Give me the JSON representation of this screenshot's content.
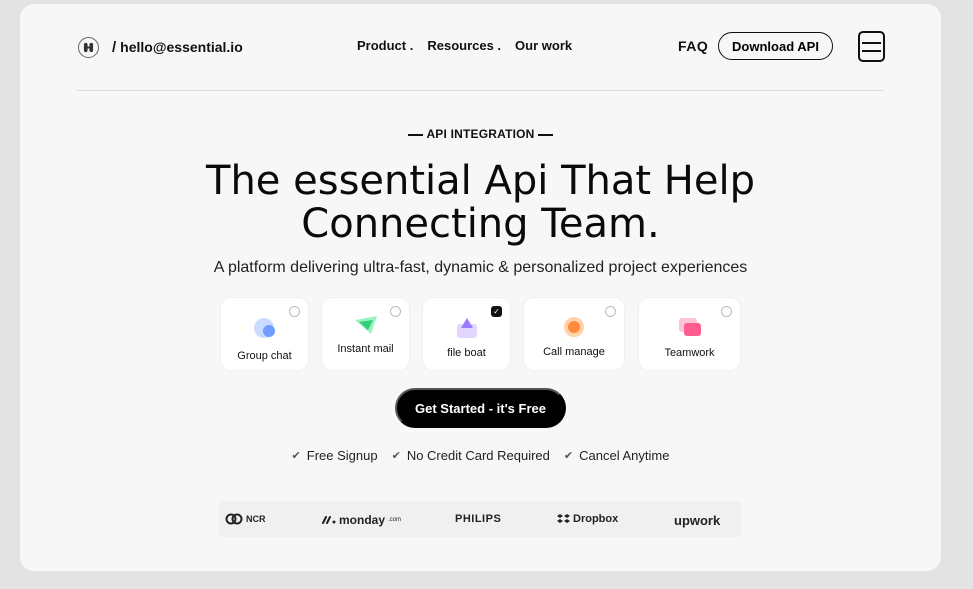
{
  "header": {
    "logo_icon": "brand-logo-icon",
    "email_prefix": "/",
    "email": "hello@essential.io",
    "nav": [
      "Product .",
      "Resources .",
      "Our work"
    ],
    "faq": "FAQ",
    "download": "Download API",
    "menu_icon": "hamburger-icon"
  },
  "hero": {
    "eyebrow": "API INTEGRATION",
    "title_line1": "The essential Api That Help",
    "title_line2": "Connecting Team.",
    "subtitle": "A platform delivering ultra-fast, dynamic & personalized project experiences"
  },
  "features": [
    {
      "label": "Group chat",
      "icon": "group-chat-icon",
      "checked": false,
      "color": "#7aa7ff"
    },
    {
      "label": "Instant mail",
      "icon": "instant-mail-icon",
      "checked": false,
      "color": "#3dd68c"
    },
    {
      "label": "file boat",
      "icon": "file-boat-icon",
      "checked": true,
      "color": "#a98bff"
    },
    {
      "label": "Call manage",
      "icon": "call-manage-icon",
      "checked": false,
      "color": "#ff9a4d"
    },
    {
      "label": "Teamwork",
      "icon": "teamwork-icon",
      "checked": false,
      "color": "#ff6fa0"
    }
  ],
  "cta": "Get Started - it's Free",
  "perks": [
    "Free Signup",
    "No Credit Card Required",
    "Cancel Anytime"
  ],
  "brands": [
    {
      "name": "NCR",
      "icon": "ncr-logo-icon"
    },
    {
      "name": "monday",
      "suffix": ".com",
      "icon": "monday-logo-icon"
    },
    {
      "name": "PHILIPS",
      "icon": "philips-logo-icon"
    },
    {
      "name": "Dropbox",
      "icon": "dropbox-logo-icon"
    },
    {
      "name": "upwork",
      "icon": "upwork-logo-icon"
    }
  ]
}
